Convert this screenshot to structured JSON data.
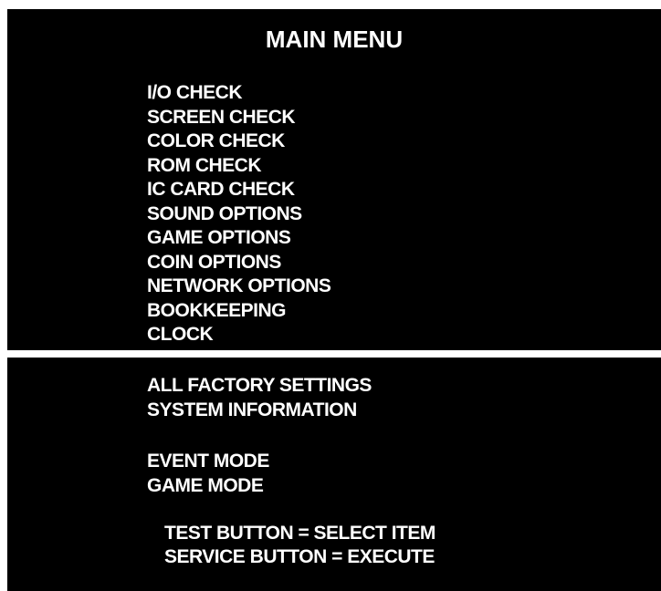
{
  "menu": {
    "title": "MAIN MENU",
    "items": [
      {
        "label": "I/O CHECK"
      },
      {
        "label": "SCREEN CHECK"
      },
      {
        "label": "COLOR CHECK"
      },
      {
        "label": "ROM CHECK"
      },
      {
        "label": "IC CARD CHECK"
      },
      {
        "label": "SOUND OPTIONS"
      },
      {
        "label": "GAME OPTIONS"
      },
      {
        "label": "COIN OPTIONS"
      },
      {
        "label": "NETWORK OPTIONS"
      },
      {
        "label": "BOOKKEEPING"
      },
      {
        "label": "CLOCK"
      }
    ],
    "settings_items": [
      {
        "label": "ALL FACTORY SETTINGS"
      },
      {
        "label": "SYSTEM INFORMATION"
      }
    ],
    "mode_items": [
      {
        "label": "EVENT MODE"
      },
      {
        "label": "GAME MODE"
      }
    ]
  },
  "instructions": {
    "line1": "TEST BUTTON = SELECT ITEM",
    "line2": "SERVICE BUTTON = EXECUTE"
  },
  "colors": {
    "background": "#000000",
    "text": "#ffffff",
    "page": "#ffffff"
  }
}
